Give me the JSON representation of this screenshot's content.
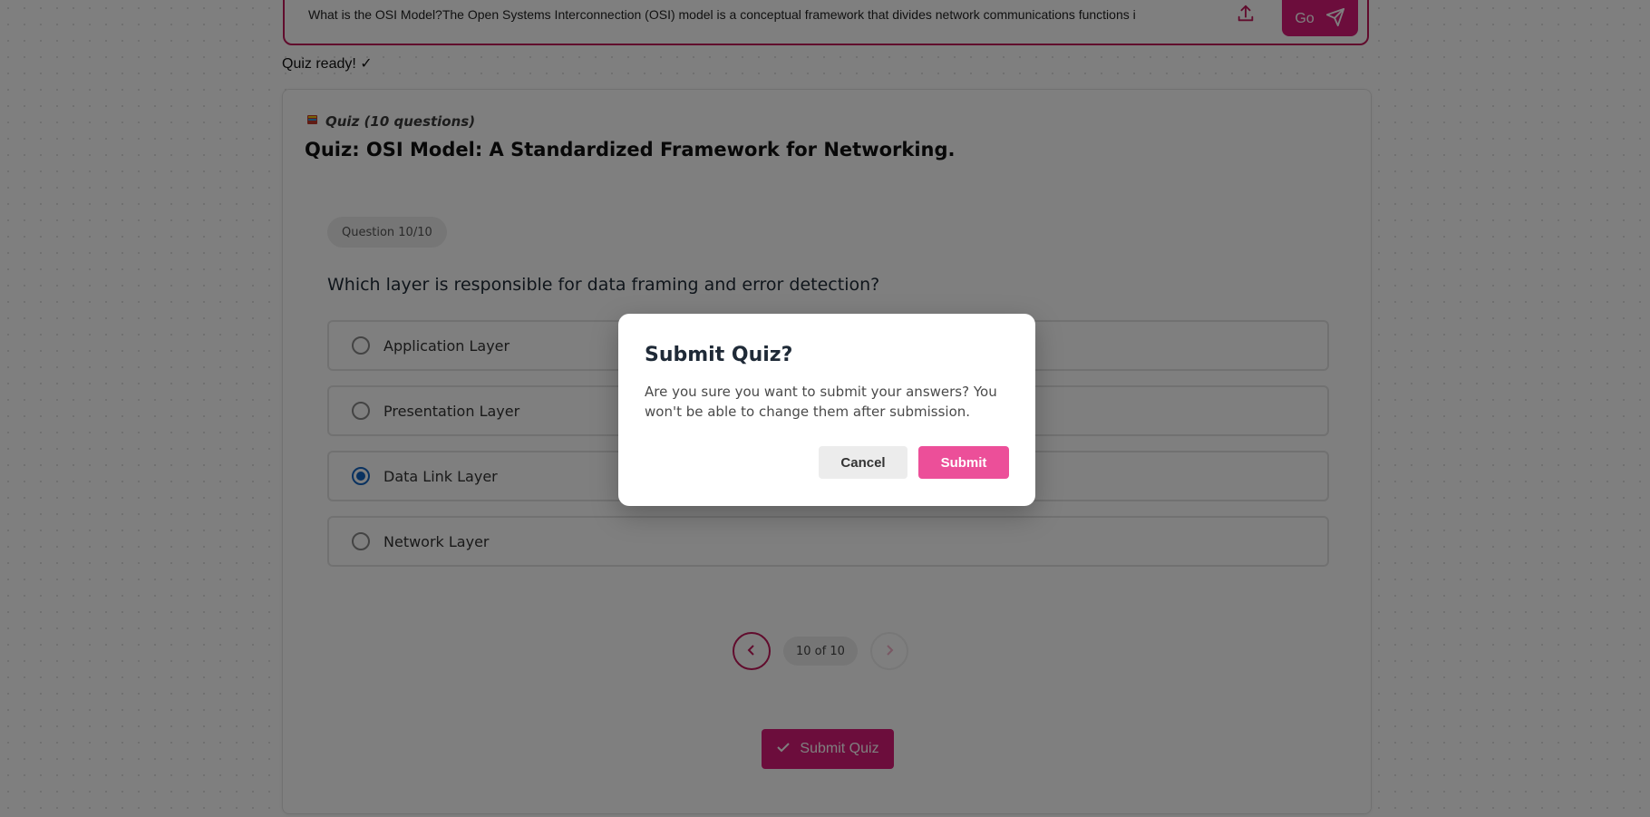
{
  "input": {
    "value": "What is the OSI Model?The Open Systems Interconnection (OSI) model is a conceptual framework that divides network communications functions i",
    "go_label": "Go"
  },
  "status": "Quiz ready! ✓",
  "quiz": {
    "count_label": "Quiz (10 questions)",
    "title": "Quiz: OSI Model: A Standardized Framework for Networking.",
    "question_badge": "Question 10/10",
    "question": "Which layer is responsible for data framing and error detection?",
    "options": [
      {
        "label": "Application Layer",
        "selected": false
      },
      {
        "label": "Presentation Layer",
        "selected": false
      },
      {
        "label": "Data Link Layer",
        "selected": true
      },
      {
        "label": "Network Layer",
        "selected": false
      }
    ],
    "pager": "10 of 10",
    "submit_label": "Submit Quiz"
  },
  "modal": {
    "title": "Submit Quiz?",
    "body": "Are you sure you want to submit your answers? You won't be able to change them after submission.",
    "cancel_label": "Cancel",
    "submit_label": "Submit"
  },
  "colors": {
    "accent": "#d81b78",
    "selected_radio": "#1565c0",
    "modal_submit": "#ec4f99"
  },
  "icons": [
    "upload-icon",
    "send-icon",
    "book-icon",
    "chevron-left-icon",
    "chevron-right-icon",
    "check-icon"
  ]
}
